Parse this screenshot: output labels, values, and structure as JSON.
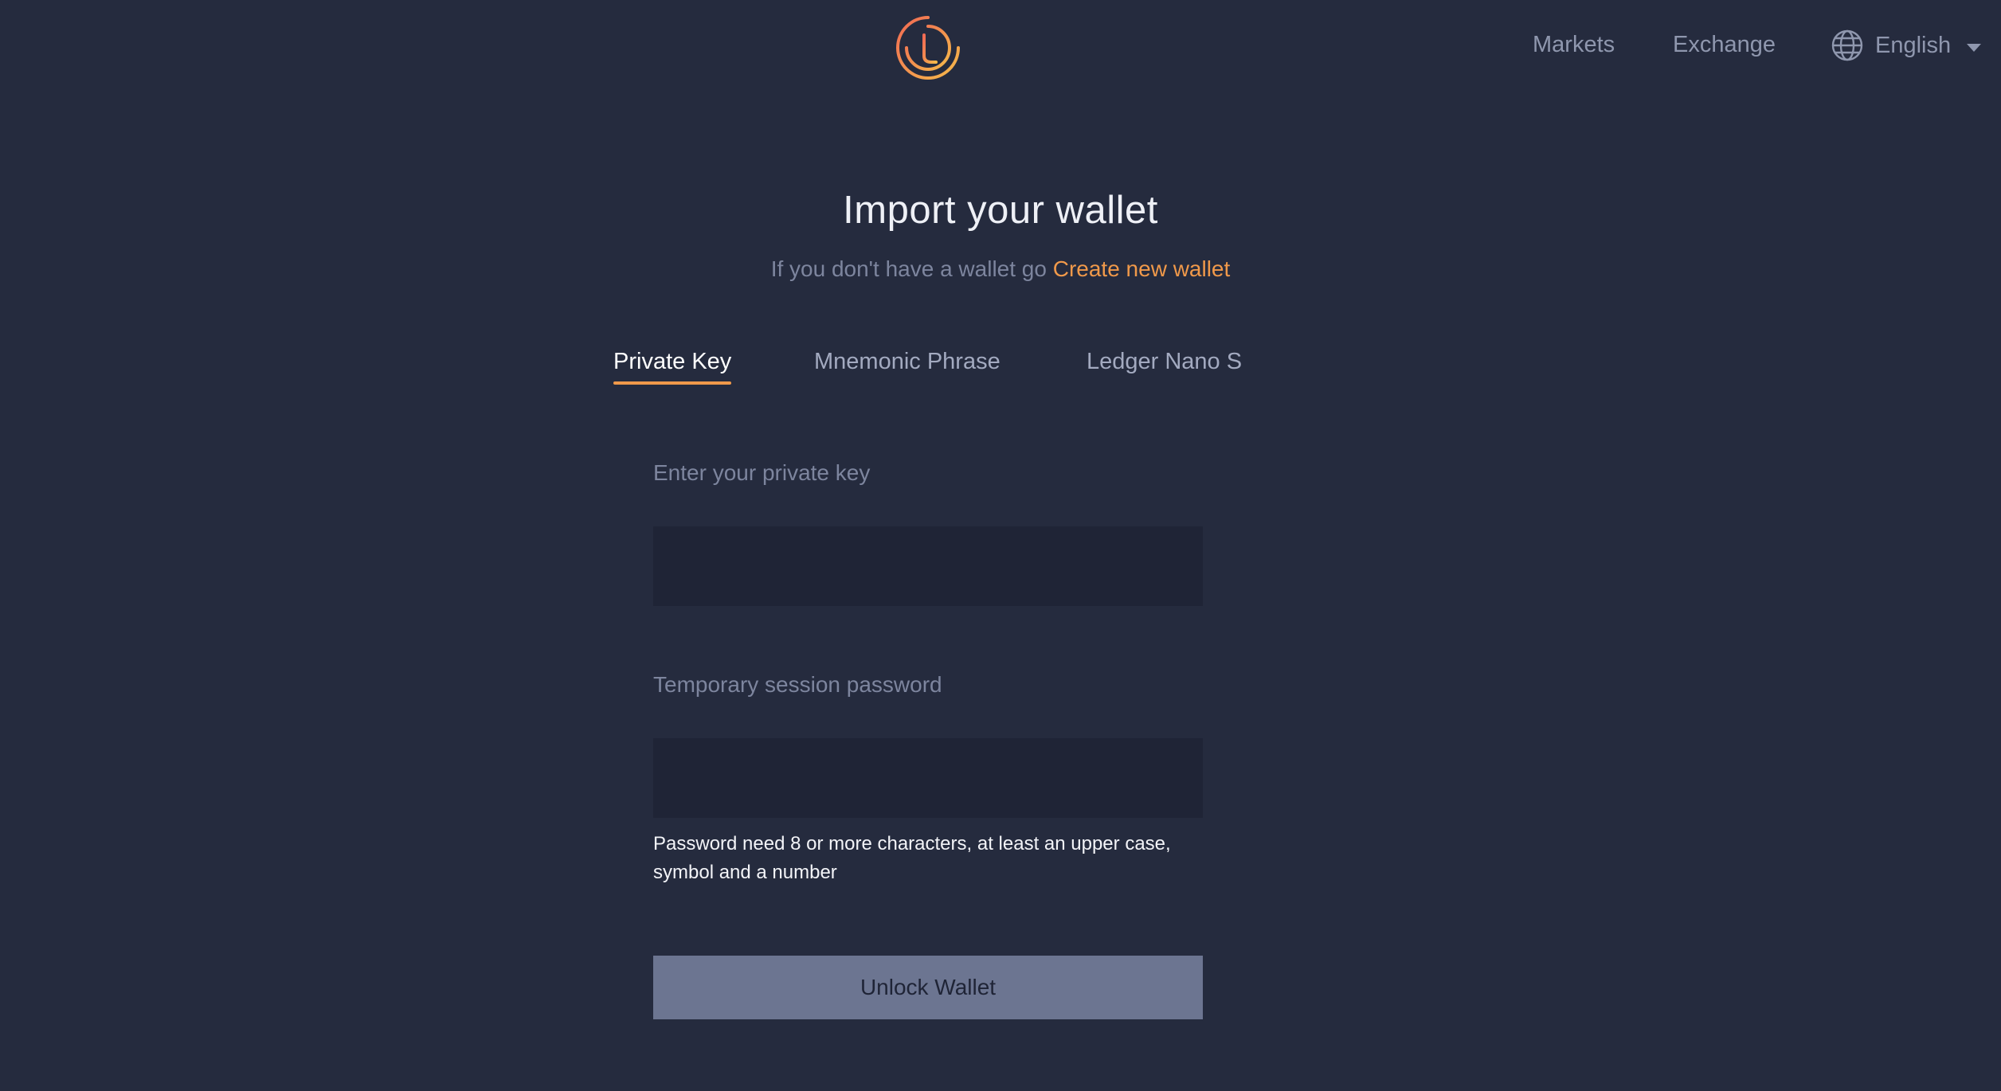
{
  "header": {
    "logo_icon": "tomo-logo-icon",
    "nav": [
      {
        "label": "Markets"
      },
      {
        "label": "Exchange"
      }
    ],
    "language": {
      "icon": "globe-icon",
      "selected": "English"
    }
  },
  "main": {
    "title": "Import your wallet",
    "subtitle_text": "If you don't have a wallet go ",
    "subtitle_link": "Create new wallet",
    "tabs": [
      {
        "label": "Private Key",
        "active": true
      },
      {
        "label": "Mnemonic Phrase",
        "active": false
      },
      {
        "label": "Ledger Nano S",
        "active": false
      }
    ],
    "form": {
      "private_key_label": "Enter your private key",
      "private_key_value": "",
      "password_label": "Temporary session password",
      "password_value": "",
      "password_hint": "Password need 8 or more characters, at least an upper case, symbol and a number",
      "submit_label": "Unlock Wallet"
    }
  },
  "colors": {
    "background": "#252b3e",
    "accent": "#f0994a",
    "input_bg": "#1f2436",
    "button_bg": "#6c7591"
  }
}
